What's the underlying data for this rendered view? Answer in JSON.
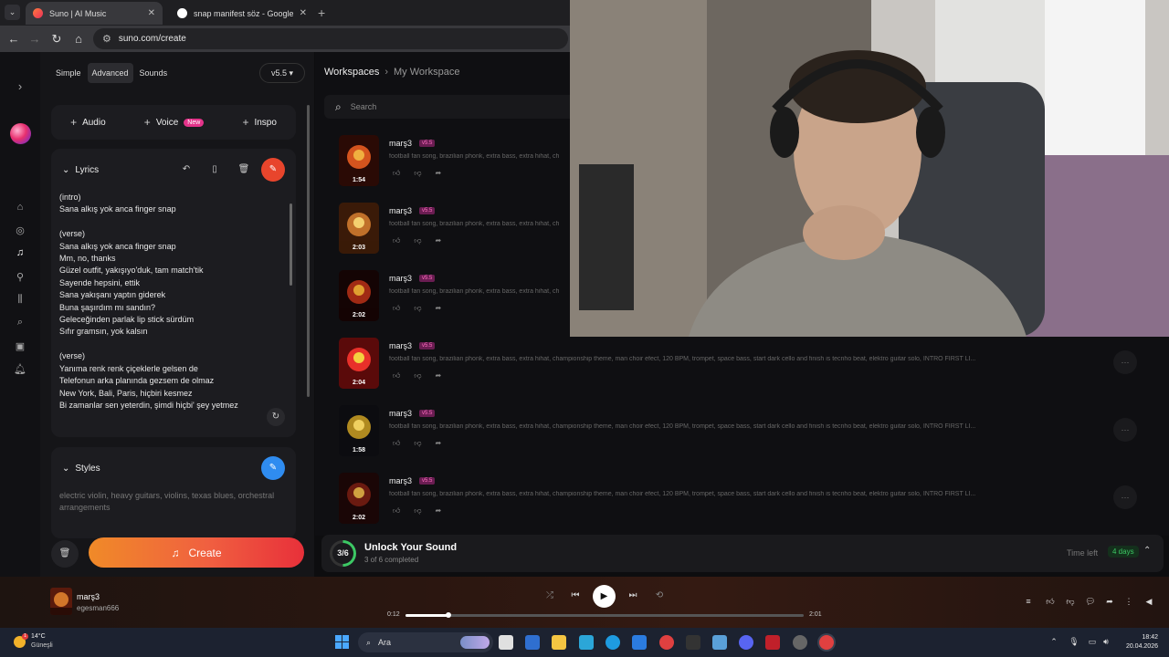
{
  "browser": {
    "tabs": [
      {
        "title": "Suno | AI Music",
        "active": true
      },
      {
        "title": "snap manifest söz - Google'da",
        "active": false
      }
    ],
    "url": "suno.com/create"
  },
  "create": {
    "modes": [
      "Simple",
      "Advanced",
      "Sounds"
    ],
    "version": "v5.5",
    "add": {
      "audio": "Audio",
      "voice": "Voice",
      "voice_badge": "New",
      "inspo": "Inspo"
    },
    "lyrics_heading": "Lyrics",
    "lyrics": "(intro)\nSana alkış yok anca finger snap\n\n(verse)\nSana alkış yok anca finger snap\nMm, no, thanks\nGüzel outfit, yakışıyo'duk, tam match'tik\nSayende hepsini, ettik\nSana yakışanı yaptın giderek\nBuna şaşırdım mı sandın?\nGeleceğinden parlak lip stick sürdüm\nSıfır gramsın, yok kalsın\n\n(verse)\nYanıma renk renk çiçeklerle gelsen de\nTelefonun arka planında gezsem de olmaz\nNew York, Bali, Paris, hiçbiri kesmez\nBi zamanlar sen yeterdin, şimdi hiçbi' şey yetmez\n(...)",
    "styles_heading": "Styles",
    "styles_placeholder": "electric violin, heavy guitars, violins, texas blues, orchestral arrangements",
    "create_label": "Create"
  },
  "workspace": {
    "breadcrumb_root": "Workspaces",
    "breadcrumb_current": "My Workspace",
    "search_placeholder": "Search",
    "songs": [
      {
        "title": "marş3",
        "version": "v5.5",
        "duration": "1:54",
        "tags": "football fan song, brazilian phonk, extra bass, extra hihat, ch"
      },
      {
        "title": "marş3",
        "version": "v5.5",
        "duration": "2:03",
        "tags": "football fan song, brazilian phonk, extra bass, extra hihat, ch"
      },
      {
        "title": "marş3",
        "version": "v5.5",
        "duration": "2:02",
        "tags": "football fan song, brazilian phonk, extra bass, extra hihat, ch"
      },
      {
        "title": "marş3",
        "version": "v5.5",
        "duration": "2:04",
        "tags": "football fan song, brazilian phonk, extra bass, extra hihat, championship theme, man choir efect, 120 BPM, trompet, space bass, start dark cello and finish is tecnho beat, elektro guitar solo, INTRO FIRST LI..."
      },
      {
        "title": "marş3",
        "version": "v5.5",
        "duration": "1:58",
        "tags": "football fan song, brazilian phonk, extra bass, extra hihat, championship theme, man choir efect, 120 BPM, trompet, space bass, start dark cello and finish is tecnho beat, elektro guitar solo, INTRO FIRST LI..."
      },
      {
        "title": "marş3",
        "version": "v5.5",
        "duration": "2:02",
        "tags": "football fan song, brazilian phonk, extra bass, extra hihat, championship theme, man choir efect, 120 BPM, trompet, space bass, start dark cello and finish is tecnho beat, elektro guitar solo, INTRO FIRST LI..."
      }
    ]
  },
  "unlock": {
    "progress_label": "3/6",
    "progress_fraction": 0.5,
    "title": "Unlock Your Sound",
    "subtitle": "3 of 6 completed",
    "time_left_label": "Time left",
    "days": "4 days"
  },
  "player": {
    "title": "marş3",
    "user": "egesman666",
    "current_time": "0:12",
    "total_time": "2:01",
    "progress_fraction": 0.107
  },
  "taskbar": {
    "temperature": "14°C",
    "weather": "Güneşli",
    "weather_alert": "1",
    "search_placeholder": "Ara",
    "time": "18:42",
    "date": "20.04.2026"
  },
  "colors": {
    "accent_create": "#f06040",
    "version_badge": "#ff6ec0",
    "unlock_green": "#3cc864",
    "magic_button": "#e8452c",
    "styles_button": "#2f8cf0"
  }
}
